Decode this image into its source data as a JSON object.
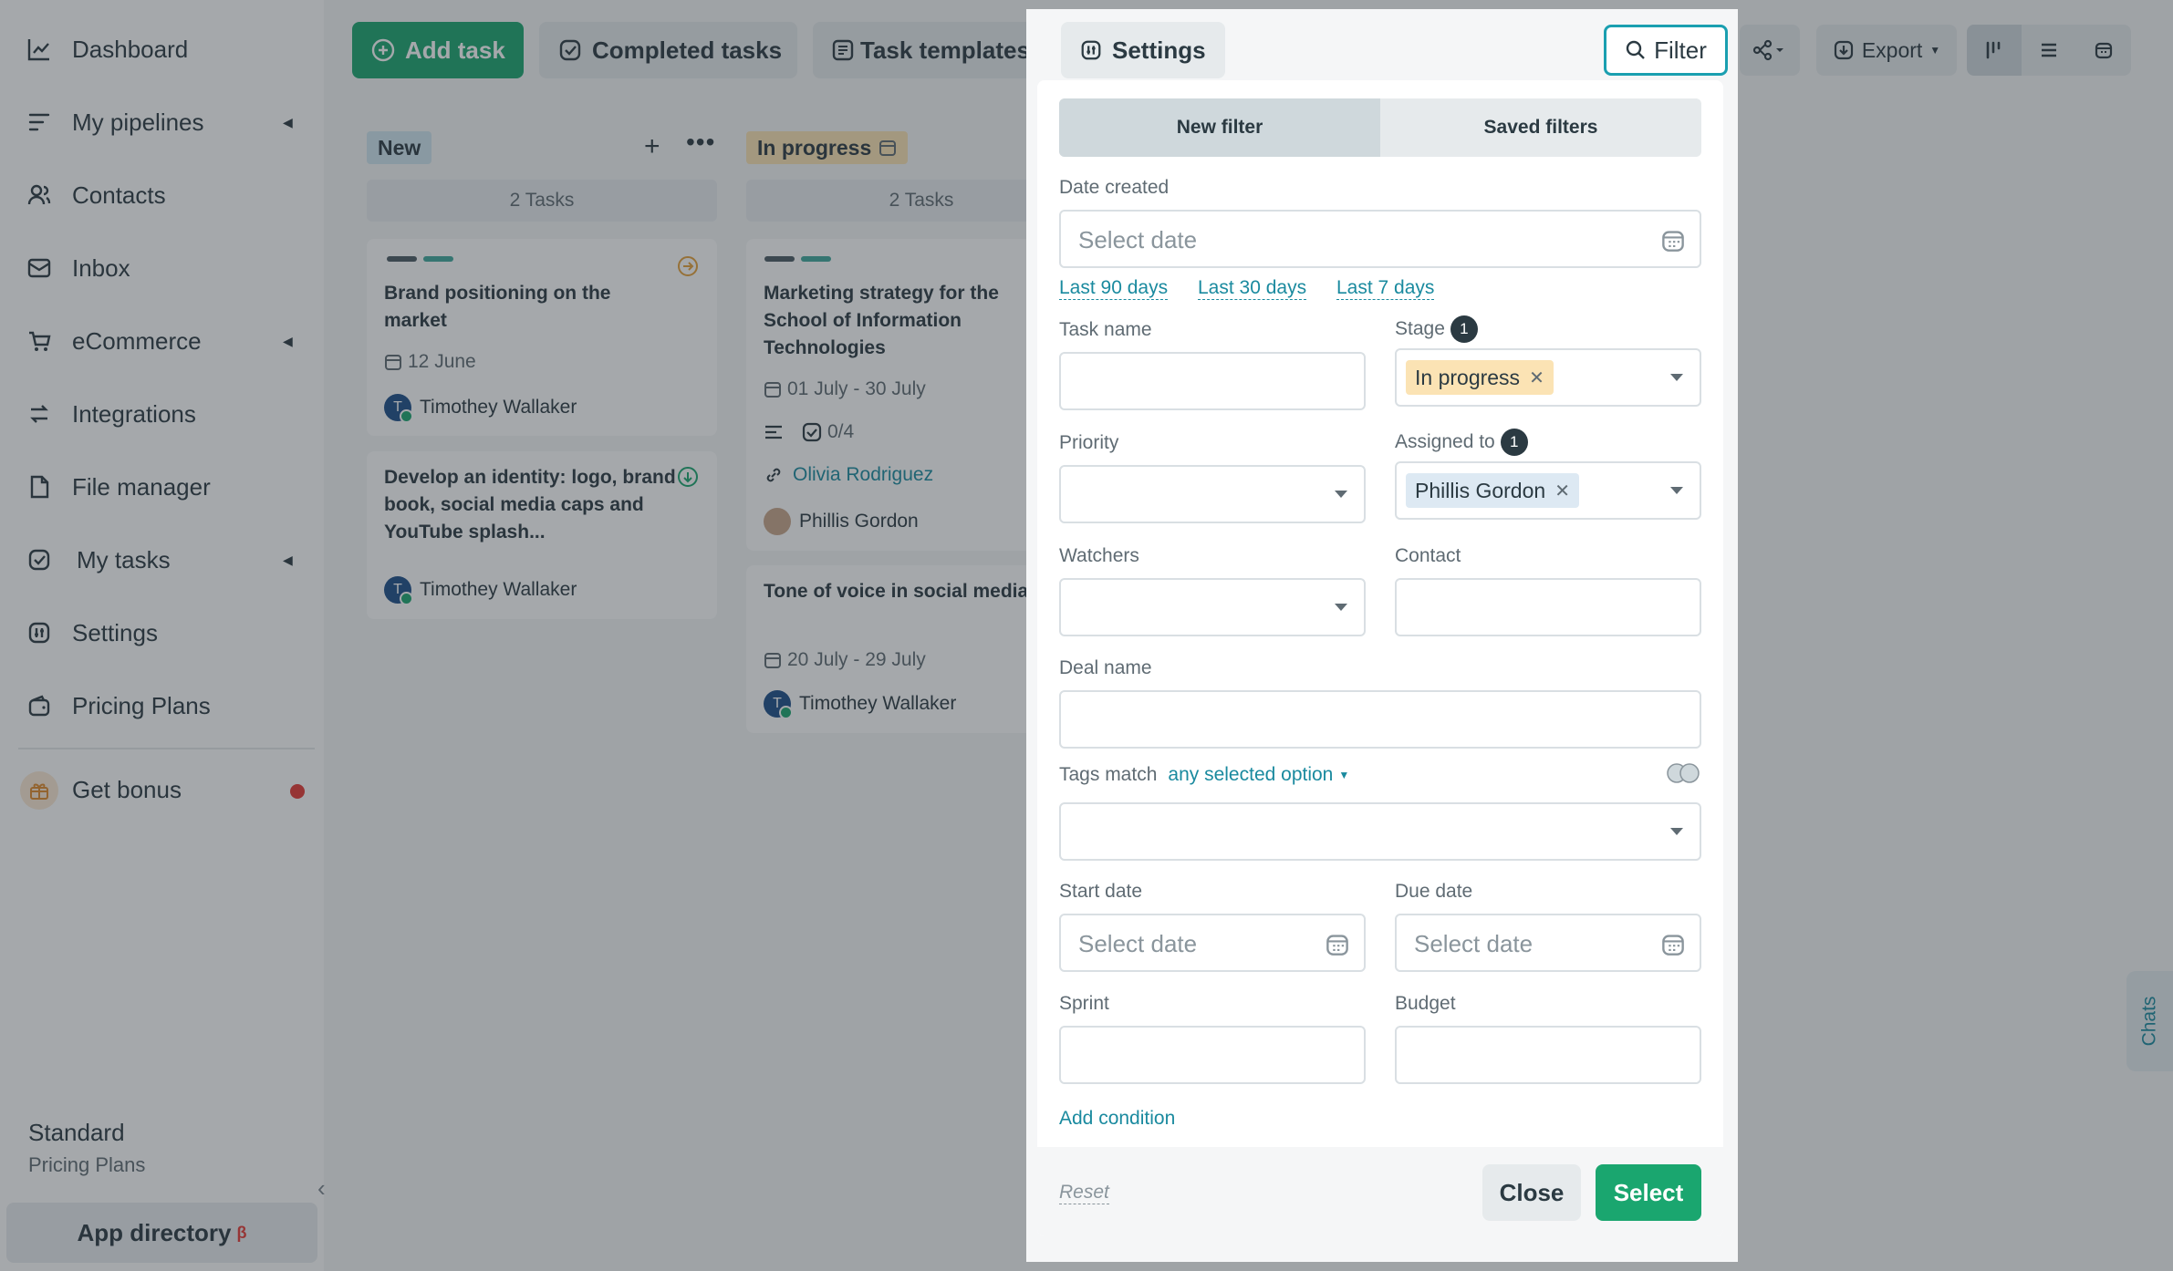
{
  "sidebar": {
    "items": [
      {
        "label": "Dashboard",
        "icon": "chart-line-icon",
        "has_caret": false
      },
      {
        "label": "My pipelines",
        "icon": "pipeline-icon",
        "has_caret": true
      },
      {
        "label": "Contacts",
        "icon": "contacts-icon",
        "has_caret": false
      },
      {
        "label": "Inbox",
        "icon": "inbox-icon",
        "has_caret": false
      },
      {
        "label": "eCommerce",
        "icon": "cart-icon",
        "has_caret": true
      },
      {
        "label": "Integrations",
        "icon": "integrations-icon",
        "has_caret": false
      },
      {
        "label": "File manager",
        "icon": "file-icon",
        "has_caret": false
      },
      {
        "label": "My tasks",
        "icon": "tasks-check-icon",
        "has_caret": true
      },
      {
        "label": "Settings",
        "icon": "settings-icon",
        "has_caret": false
      },
      {
        "label": "Pricing Plans",
        "icon": "wallet-icon",
        "has_caret": false
      }
    ],
    "bonus": "Get bonus",
    "plan_name": "Standard",
    "plan_sub": "Pricing Plans",
    "app_directory": "App directory",
    "app_directory_badge": "β"
  },
  "toolbar": {
    "add_task": "Add task",
    "completed_tasks": "Completed tasks",
    "task_templates": "Task templates",
    "settings": "Settings",
    "filter": "Filter",
    "export": "Export"
  },
  "board": {
    "columns": [
      {
        "name": "New",
        "count": "2 Tasks",
        "badge_color": "#cfe6ef",
        "cards": [
          {
            "title": "Brand positioning on the market",
            "date": "12 June",
            "assignee": "Timothey Wallaker",
            "avatar": "T"
          },
          {
            "title": "Develop an identity: logo, brand book, social media caps and YouTube splash...",
            "assignee": "Timothey Wallaker",
            "avatar": "T"
          }
        ]
      },
      {
        "name": "In progress",
        "count": "2 Tasks",
        "badge_color": "#fbe3b4",
        "cards": [
          {
            "title": "Marketing strategy for the School of Information Technologies",
            "date": "01 July - 30 July",
            "checklist": "0/4",
            "contact": "Olivia Rodriguez",
            "assignee": "Phillis Gordon"
          },
          {
            "title": "Tone of voice in social media",
            "date": "20 July - 29 July",
            "assignee": "Timothey Wallaker",
            "avatar": "T"
          }
        ]
      }
    ]
  },
  "filter_panel": {
    "tabs": [
      "New filter",
      "Saved filters"
    ],
    "date_created_label": "Date created",
    "date_placeholder": "Select date",
    "quick_ranges": [
      "Last 90 days",
      "Last 30 days",
      "Last 7 days"
    ],
    "task_name_label": "Task name",
    "stage_label": "Stage",
    "stage_count": "1",
    "stage_value": "In progress",
    "priority_label": "Priority",
    "assigned_label": "Assigned to",
    "assigned_count": "1",
    "assigned_value": "Phillis Gordon",
    "watchers_label": "Watchers",
    "contact_label": "Contact",
    "deal_name_label": "Deal name",
    "tags_match_label": "Tags match",
    "tags_match_value": "any selected option",
    "start_date_label": "Start date",
    "due_date_label": "Due date",
    "sprint_label": "Sprint",
    "budget_label": "Budget",
    "add_condition": "Add condition",
    "reset": "Reset",
    "close": "Close",
    "select": "Select"
  },
  "chats": "Chats",
  "colors": {
    "accent_green": "#1aa66f",
    "link_teal": "#1a8a9f",
    "stage_chip": "#fbe3b4",
    "assignee_chip": "#dde9f3"
  }
}
